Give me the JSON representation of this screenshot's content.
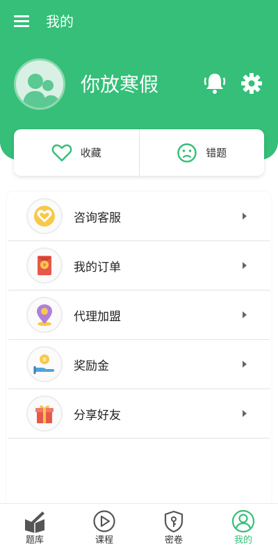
{
  "header": {
    "title": "我的",
    "username": "你放寒假"
  },
  "quick_actions": [
    {
      "label": "收藏",
      "icon": "heart-icon"
    },
    {
      "label": "错题",
      "icon": "sad-face-icon"
    }
  ],
  "menu": [
    {
      "label": "咨询客服",
      "icon": "heart-badge-icon"
    },
    {
      "label": "我的订单",
      "icon": "red-envelope-icon"
    },
    {
      "label": "代理加盟",
      "icon": "location-pin-icon"
    },
    {
      "label": "奖励金",
      "icon": "coin-hand-icon"
    },
    {
      "label": "分享好友",
      "icon": "gift-box-icon"
    }
  ],
  "tabs": [
    {
      "label": "题库",
      "icon": "book-pen-icon",
      "active": false
    },
    {
      "label": "课程",
      "icon": "play-circle-icon",
      "active": false
    },
    {
      "label": "密卷",
      "icon": "shield-key-icon",
      "active": false
    },
    {
      "label": "我的",
      "icon": "user-icon",
      "active": true
    }
  ],
  "colors": {
    "accent": "#35bf78",
    "text": "#222222",
    "inactive_icon": "#555555"
  }
}
